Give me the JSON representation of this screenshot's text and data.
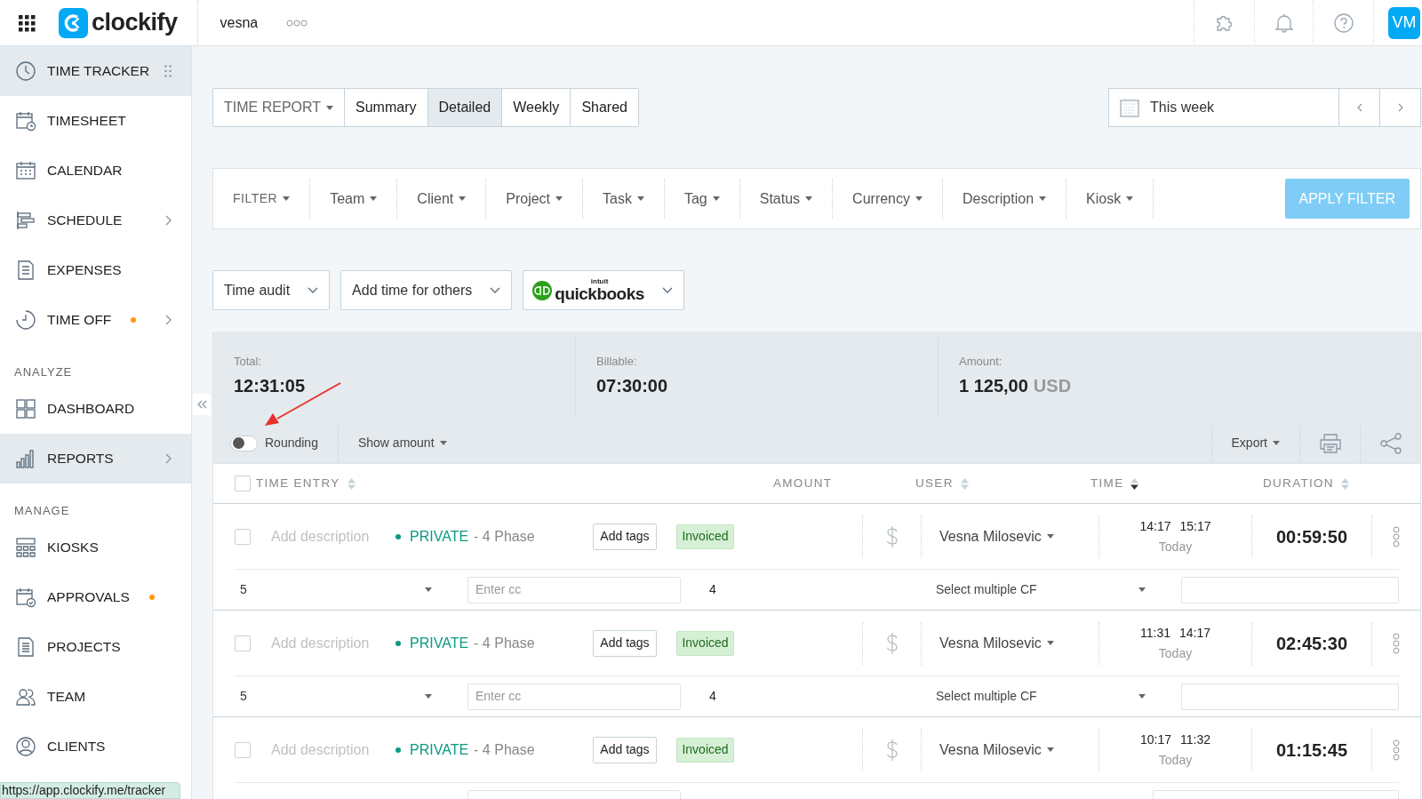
{
  "topbar": {
    "brand": "clockify",
    "workspace": "vesna",
    "avatar": "VM"
  },
  "sidebar": {
    "groups": [
      {
        "items": [
          {
            "label": "TIME TRACKER",
            "selected": true,
            "expandable": false,
            "notification": false
          },
          {
            "label": "TIMESHEET",
            "selected": false,
            "expandable": false,
            "notification": false
          },
          {
            "label": "CALENDAR",
            "selected": false,
            "expandable": false,
            "notification": false
          },
          {
            "label": "SCHEDULE",
            "selected": false,
            "expandable": true,
            "notification": false
          },
          {
            "label": "EXPENSES",
            "selected": false,
            "expandable": false,
            "notification": false
          },
          {
            "label": "TIME OFF",
            "selected": false,
            "expandable": true,
            "notification": true
          }
        ]
      },
      {
        "heading": "ANALYZE",
        "items": [
          {
            "label": "DASHBOARD",
            "selected": false,
            "expandable": false,
            "notification": false
          },
          {
            "label": "REPORTS",
            "selected": true,
            "expandable": true,
            "notification": false
          }
        ]
      },
      {
        "heading": "MANAGE",
        "items": [
          {
            "label": "KIOSKS",
            "selected": false,
            "expandable": false,
            "notification": false
          },
          {
            "label": "APPROVALS",
            "selected": false,
            "expandable": false,
            "notification": true
          },
          {
            "label": "PROJECTS",
            "selected": false,
            "expandable": false,
            "notification": false
          },
          {
            "label": "TEAM",
            "selected": false,
            "expandable": false,
            "notification": false
          },
          {
            "label": "CLIENTS",
            "selected": false,
            "expandable": false,
            "notification": false
          }
        ]
      }
    ]
  },
  "report_tabs": {
    "dropdown": "TIME REPORT",
    "tabs": [
      {
        "label": "Summary",
        "selected": false
      },
      {
        "label": "Detailed",
        "selected": true
      },
      {
        "label": "Weekly",
        "selected": false
      },
      {
        "label": "Shared",
        "selected": false
      }
    ]
  },
  "date_range": {
    "label": "This week"
  },
  "filters": {
    "items": [
      "FILTER",
      "Team",
      "Client",
      "Project",
      "Task",
      "Tag",
      "Status",
      "Currency",
      "Description",
      "Kiosk"
    ],
    "apply": "APPLY FILTER"
  },
  "actions": [
    "Time audit",
    "Add time for others"
  ],
  "quickbooks": {
    "prefix": "intuit",
    "label": "quickbooks"
  },
  "summary": {
    "stats": [
      {
        "label": "Total:",
        "value": "12:31:05"
      },
      {
        "label": "Billable:",
        "value": "07:30:00"
      },
      {
        "label": "Amount:",
        "value": "1 125,00",
        "unit": "USD"
      }
    ],
    "rounding": {
      "label": "Rounding",
      "on": false
    },
    "show_amount": "Show amount",
    "export": "Export"
  },
  "table": {
    "all_checked": false,
    "columns": [
      {
        "label": "TIME ENTRY",
        "sortable": true,
        "sorted": false
      },
      {
        "label": "AMOUNT",
        "sortable": false
      },
      {
        "label": "USER",
        "sortable": true,
        "sorted": false
      },
      {
        "label": "TIME",
        "sortable": true,
        "sorted": true
      },
      {
        "label": "DURATION",
        "sortable": true,
        "sorted": false
      }
    ],
    "rows": [
      {
        "checked": false,
        "description": "Add description",
        "project": "PRIVATE",
        "task": "- 4 Phase",
        "tags": "Add tags",
        "badge": "Invoiced",
        "billable": false,
        "user": "Vesna Milosevic",
        "start": "14:17",
        "end": "15:17",
        "date": "Today",
        "duration": "00:59:50",
        "custom_fields": {
          "number": "5",
          "cc_placeholder": "Enter cc",
          "value": "4",
          "select": "Select multiple CF"
        }
      },
      {
        "checked": false,
        "description": "Add description",
        "project": "PRIVATE",
        "task": "- 4 Phase",
        "tags": "Add tags",
        "badge": "Invoiced",
        "billable": false,
        "user": "Vesna Milosevic",
        "start": "11:31",
        "end": "14:17",
        "date": "Today",
        "duration": "02:45:30",
        "custom_fields": {
          "number": "5",
          "cc_placeholder": "Enter cc",
          "value": "4",
          "select": "Select multiple CF"
        }
      },
      {
        "checked": false,
        "description": "Add description",
        "project": "PRIVATE",
        "task": "- 4 Phase",
        "tags": "Add tags",
        "badge": "Invoiced",
        "billable": false,
        "user": "Vesna Milosevic",
        "start": "10:17",
        "end": "11:32",
        "date": "Today",
        "duration": "01:15:45"
      }
    ]
  },
  "status_url": "https://app.clockify.me/tracker"
}
